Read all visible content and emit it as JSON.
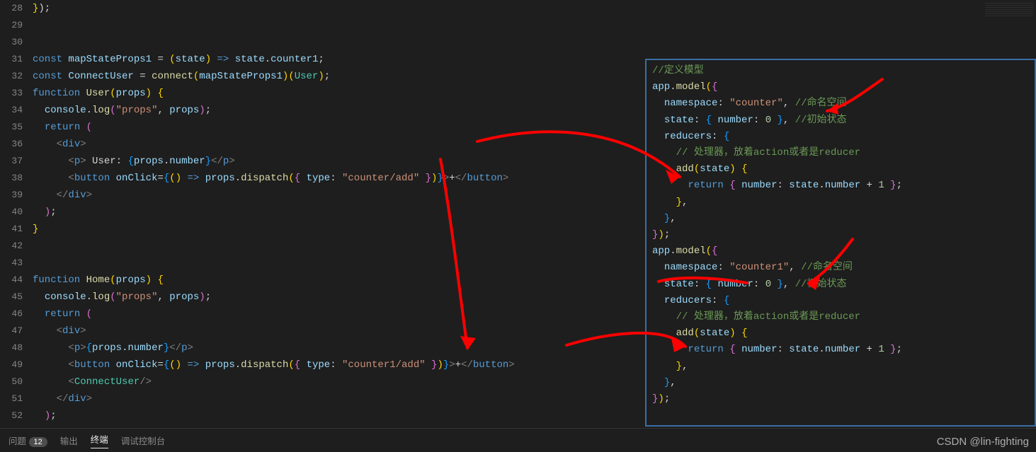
{
  "leftCode": {
    "startLine": 28,
    "lines": [
      {
        "n": 28,
        "html": "<span class='yl'>}</span><span class='pun'>);</span>"
      },
      {
        "n": 29,
        "html": ""
      },
      {
        "n": 30,
        "html": ""
      },
      {
        "n": 31,
        "html": "<span class='kw'>const</span> <span class='var'>mapStateProps1</span> <span class='op'>=</span> <span class='yl'>(</span><span class='var'>state</span><span class='yl'>)</span> <span class='kw'>=&gt;</span> <span class='var'>state</span><span class='pun'>.</span><span class='var'>counter1</span><span class='pun'>;</span>"
      },
      {
        "n": 32,
        "html": "<span class='kw'>const</span> <span class='var'>ConnectUser</span> <span class='op'>=</span> <span class='fn'>connect</span><span class='yl'>(</span><span class='var'>mapStateProps1</span><span class='yl'>)</span><span class='yl'>(</span><span class='typ'>User</span><span class='yl'>)</span><span class='pun'>;</span>"
      },
      {
        "n": 33,
        "html": "<span class='kw'>function</span> <span class='fn'>User</span><span class='yl'>(</span><span class='var'>props</span><span class='yl'>)</span> <span class='yl'>{</span>"
      },
      {
        "n": 34,
        "html": "  <span class='var'>console</span><span class='pun'>.</span><span class='fn'>log</span><span class='pk'>(</span><span class='str'>\"props\"</span><span class='pun'>,</span> <span class='var'>props</span><span class='pk'>)</span><span class='pun'>;</span>"
      },
      {
        "n": 35,
        "html": "  <span class='kw'>return</span> <span class='pk'>(</span>"
      },
      {
        "n": 36,
        "html": "    <span class='tag'>&lt;</span><span class='tagn'>div</span><span class='tag'>&gt;</span>"
      },
      {
        "n": 37,
        "html": "      <span class='tag'>&lt;</span><span class='tagn'>p</span><span class='tag'>&gt;</span> User: <span class='bl'>{</span><span class='var'>props</span><span class='pun'>.</span><span class='var'>number</span><span class='bl'>}</span><span class='tag'>&lt;/</span><span class='tagn'>p</span><span class='tag'>&gt;</span>"
      },
      {
        "n": 38,
        "html": "      <span class='tag'>&lt;</span><span class='tagn'>button</span> <span class='var'>onClick</span><span class='op'>=</span><span class='bl'>{</span><span class='yl'>(</span><span class='yl'>)</span> <span class='kw'>=&gt;</span> <span class='var'>props</span><span class='pun'>.</span><span class='fn'>dispatch</span><span class='yl'>(</span><span class='pk'>{</span> <span class='var'>type</span><span class='pun'>:</span> <span class='str'>\"counter/add\"</span> <span class='pk'>}</span><span class='yl'>)</span><span class='bl'>}</span><span class='tag'>&gt;</span>+<span class='tag'>&lt;/</span><span class='tagn'>button</span><span class='tag'>&gt;</span>"
      },
      {
        "n": 39,
        "html": "    <span class='tag'>&lt;/</span><span class='tagn'>div</span><span class='tag'>&gt;</span>"
      },
      {
        "n": 40,
        "html": "  <span class='pk'>)</span><span class='pun'>;</span>"
      },
      {
        "n": 41,
        "html": "<span class='yl'>}</span>"
      },
      {
        "n": 42,
        "html": ""
      },
      {
        "n": 43,
        "html": ""
      },
      {
        "n": 44,
        "html": "<span class='kw'>function</span> <span class='fn'>Home</span><span class='yl'>(</span><span class='var'>props</span><span class='yl'>)</span> <span class='yl'>{</span>"
      },
      {
        "n": 45,
        "html": "  <span class='var'>console</span><span class='pun'>.</span><span class='fn'>log</span><span class='pk'>(</span><span class='str'>\"props\"</span><span class='pun'>,</span> <span class='var'>props</span><span class='pk'>)</span><span class='pun'>;</span>"
      },
      {
        "n": 46,
        "html": "  <span class='kw'>return</span> <span class='pk'>(</span>"
      },
      {
        "n": 47,
        "html": "    <span class='tag'>&lt;</span><span class='tagn'>div</span><span class='tag'>&gt;</span>"
      },
      {
        "n": 48,
        "html": "      <span class='tag'>&lt;</span><span class='tagn'>p</span><span class='tag'>&gt;</span><span class='bl'>{</span><span class='var'>props</span><span class='pun'>.</span><span class='var'>number</span><span class='bl'>}</span><span class='tag'>&lt;/</span><span class='tagn'>p</span><span class='tag'>&gt;</span>"
      },
      {
        "n": 49,
        "html": "      <span class='tag'>&lt;</span><span class='tagn'>button</span> <span class='var'>onClick</span><span class='op'>=</span><span class='bl'>{</span><span class='yl'>(</span><span class='yl'>)</span> <span class='kw'>=&gt;</span> <span class='var'>props</span><span class='pun'>.</span><span class='fn'>dispatch</span><span class='yl'>(</span><span class='pk'>{</span> <span class='var'>type</span><span class='pun'>:</span> <span class='str'>\"counter1/add\"</span> <span class='pk'>}</span><span class='yl'>)</span><span class='bl'>}</span><span class='tag'>&gt;</span>+<span class='tag'>&lt;/</span><span class='tagn'>button</span><span class='tag'>&gt;</span>"
      },
      {
        "n": 50,
        "html": "      <span class='tag'>&lt;</span><span class='typ'>ConnectUser</span><span class='tag'>/&gt;</span>"
      },
      {
        "n": 51,
        "html": "    <span class='tag'>&lt;/</span><span class='tagn'>div</span><span class='tag'>&gt;</span>"
      },
      {
        "n": 52,
        "html": "  <span class='pk'>)</span><span class='pun'>;</span>"
      }
    ]
  },
  "rightCode": {
    "lines": [
      "<span class='cmt'>//定义模型</span>",
      "<span class='var'>app</span><span class='pun'>.</span><span class='fn'>model</span><span class='yl'>(</span><span class='pk'>{</span>",
      "  <span class='var'>namespace</span><span class='pun'>:</span> <span class='str'>\"counter\"</span><span class='pun'>,</span> <span class='cmt'>//命名空间</span>",
      "  <span class='var'>state</span><span class='pun'>:</span> <span class='bl'>{</span> <span class='var'>number</span><span class='pun'>:</span> <span class='num'>0</span> <span class='bl'>}</span><span class='pun'>,</span> <span class='cmt'>//初始状态</span>",
      "  <span class='var'>reducers</span><span class='pun'>:</span> <span class='bl'>{</span>",
      "    <span class='cmt'>// 处理器，放着action或者是reducer</span>",
      "    <span class='fn'>add</span><span class='yl'>(</span><span class='var'>state</span><span class='yl'>)</span> <span class='yl'>{</span>",
      "      <span class='kw'>return</span> <span class='pk'>{</span> <span class='var'>number</span><span class='pun'>:</span> <span class='var'>state</span><span class='pun'>.</span><span class='var'>number</span> <span class='op'>+</span> <span class='num'>1</span> <span class='pk'>}</span><span class='pun'>;</span>",
      "    <span class='yl'>}</span><span class='pun'>,</span>",
      "  <span class='bl'>}</span><span class='pun'>,</span>",
      "<span class='pk'>}</span><span class='yl'>)</span><span class='pun'>;</span>",
      "<span class='var'>app</span><span class='pun'>.</span><span class='fn'>model</span><span class='yl'>(</span><span class='pk'>{</span>",
      "  <span class='var'>namespace</span><span class='pun'>:</span> <span class='str'>\"counter1\"</span><span class='pun'>,</span> <span class='cmt'>//命名空间</span>",
      "  <span class='var'>state</span><span class='pun'>:</span> <span class='bl'>{</span> <span class='var'>number</span><span class='pun'>:</span> <span class='num'>0</span> <span class='bl'>}</span><span class='pun'>,</span> <span class='cmt'>//初始状态</span>",
      "  <span class='var'>reducers</span><span class='pun'>:</span> <span class='bl'>{</span>",
      "    <span class='cmt'>// 处理器，放着action或者是reducer</span>",
      "    <span class='fn'>add</span><span class='yl'>(</span><span class='var'>state</span><span class='yl'>)</span> <span class='yl'>{</span>",
      "      <span class='kw'>return</span> <span class='pk'>{</span> <span class='var'>number</span><span class='pun'>:</span> <span class='var'>state</span><span class='pun'>.</span><span class='var'>number</span> <span class='op'>+</span> <span class='num'>1</span> <span class='pk'>}</span><span class='pun'>;</span>",
      "    <span class='yl'>}</span><span class='pun'>,</span>",
      "  <span class='bl'>}</span><span class='pun'>,</span>",
      "<span class='pk'>}</span><span class='yl'>)</span><span class='pun'>;</span>"
    ]
  },
  "bottomPanel": {
    "problems": "问题",
    "problemsCount": "12",
    "output": "输出",
    "terminal": "终端",
    "debugConsole": "调试控制台"
  },
  "watermark": "CSDN @lin-fighting"
}
